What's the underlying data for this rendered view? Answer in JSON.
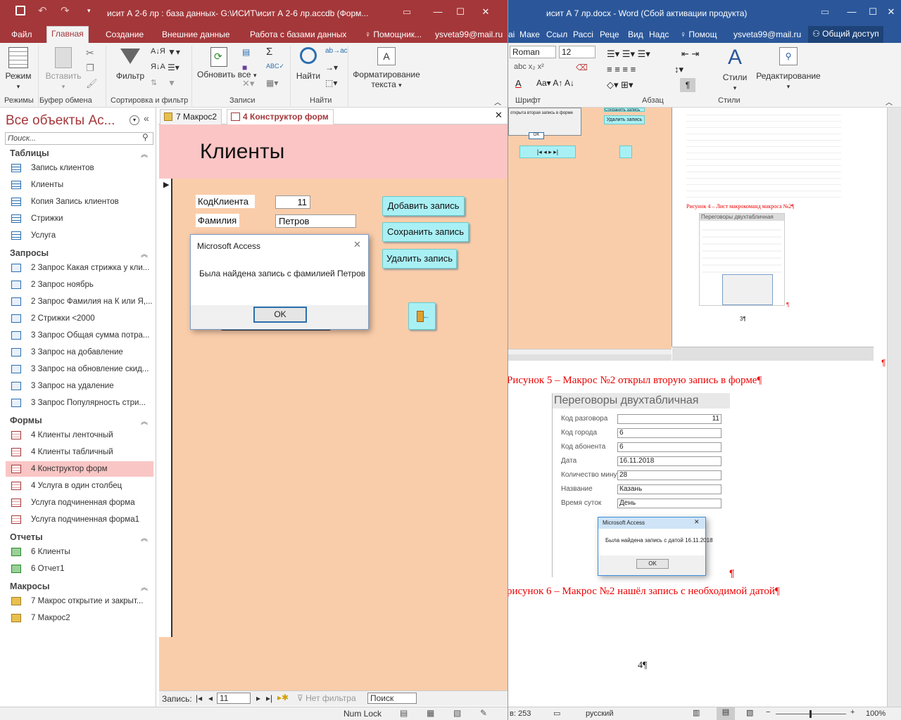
{
  "access": {
    "title": "исит А 2-6 лр : база данных- G:\\ИСИТ\\исит А 2-6 лр.accdb (Форм...",
    "tabs": [
      "Файл",
      "Главная",
      "Создание",
      "Внешние данные",
      "Работа с базами данных"
    ],
    "tell_me": "Помощник...",
    "user": "ysveta99@mail.ru",
    "ribbon": {
      "view": "Режим",
      "paste": "Вставить",
      "filter": "Фильтр",
      "refresh_all": "Обновить все",
      "find": "Найти",
      "format_text": "Форматирование текста",
      "groups": [
        "Режимы",
        "Буфер обмена",
        "Сортировка и фильтр",
        "Записи",
        "Найти"
      ]
    },
    "nav": {
      "title": "Все объекты Ac...",
      "search_placeholder": "Поиск...",
      "sections": [
        {
          "title": "Таблицы",
          "items": [
            "Запись клиентов",
            "Клиенты",
            "Копия Запись клиентов",
            "Стрижки",
            "Услуга"
          ]
        },
        {
          "title": "Запросы",
          "items": [
            "2 Запрос Какая стрижка у кли...",
            "2 Запрос ноябрь",
            "2 Запрос Фамилия на К или Я,...",
            "2 Стрижки <2000",
            "3 Запрос Общая сумма потра...",
            "3 Запрос на добавление",
            "3 Запрос на обновление скид...",
            "3 Запрос на удаление",
            "3 Запрос Популярность стри..."
          ]
        },
        {
          "title": "Формы",
          "items": [
            "4 Клиенты ленточный",
            "4 Клиенты табличный",
            "4 Конструктор форм",
            "4 Услуга в один столбец",
            "Услуга подчиненная форма",
            "Услуга подчиненная форма1"
          ]
        },
        {
          "title": "Отчеты",
          "items": [
            "6 Клиенты",
            "6 Отчет1"
          ]
        },
        {
          "title": "Макросы",
          "items": [
            "7 Макрос открытие и закрыт...",
            "7 Макрос2"
          ]
        }
      ],
      "selected": "4 Конструктор форм"
    },
    "doc_tabs": [
      "7 Макрос2",
      "4 Конструктор форм"
    ],
    "form": {
      "header": "Клиенты",
      "fields": [
        {
          "label": "КодКлиента",
          "value": "11"
        },
        {
          "label": "Фамилия",
          "value": "Петров"
        }
      ],
      "buttons": [
        "Добавить запись",
        "Сохранить запись",
        "Удалить запись"
      ]
    },
    "dialog": {
      "title": "Microsoft Access",
      "message": "Была найдена запись с фамилией Петров",
      "ok": "OK"
    },
    "record_nav": {
      "label": "Запись:",
      "current": "11",
      "filter": "Нет фильтра",
      "search": "Поиск"
    },
    "status": {
      "numlock": "Num Lock"
    }
  },
  "word": {
    "title": "исит А 7 лр.docx - Word (Сбой активации продукта)",
    "tabs": [
      "ai",
      "Маке",
      "Ссыл",
      "Рассі",
      "Реце",
      "Вид",
      "Надс"
    ],
    "tell_me": "Помощ",
    "user": "ysveta99@mail.ru",
    "share": "Общий доступ",
    "ribbon": {
      "font": "Roman",
      "size": "12",
      "styles": "Стили",
      "editing": "Редактирование",
      "groups": [
        "Шрифт",
        "Абзац",
        "Стили"
      ]
    },
    "caption4": "Рисунок 4 – Лист макрокоманд макроса №2¶",
    "caption5": "Рисунок 5 – Макрос №2 открыл вторую запись в форме¶",
    "caption6": "рисунок 6 – Макрос №2 нашёл запись с необходимой датой¶",
    "page_num_small": "3¶",
    "page_num": "4¶",
    "fig6": {
      "title": "Переговоры двухтабличная",
      "rows": [
        {
          "label": "Код разговора",
          "value": "11"
        },
        {
          "label": "Код города",
          "value": "6"
        },
        {
          "label": "Код абонента",
          "value": "6"
        },
        {
          "label": "Дата",
          "value": "16.11.2018"
        },
        {
          "label": "Количество минут",
          "value": "28"
        },
        {
          "label": "Название",
          "value": "Казань"
        },
        {
          "label": "Время суток",
          "value": "День"
        }
      ],
      "dialog_title": "Microsoft Access",
      "dialog_msg": "Была найдена запись с датой 16.11.2018",
      "ok": "OK"
    },
    "top_buttons": [
      "Сохранить запись",
      "Удалить запись"
    ],
    "top_dialog_msg": "открыта вторая запись в форме",
    "status": {
      "words": "в: 253",
      "lang": "русский",
      "zoom": "100%"
    }
  },
  "colors": {
    "access_red": "#a4373a",
    "word_blue": "#2b579a",
    "caption_red": "#ee0000",
    "cmd_cyan": "#a9f0f5",
    "form_bg": "#facdaa",
    "header_pink": "#fbc5c5"
  }
}
